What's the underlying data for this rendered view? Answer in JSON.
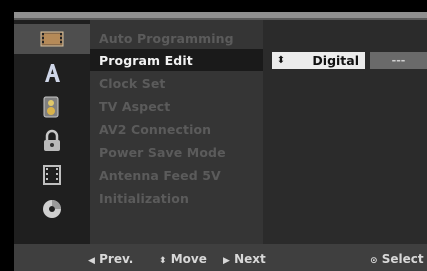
{
  "icons": [
    "video-icon",
    "language-icon",
    "audio-icon",
    "lock-icon",
    "recording-icon",
    "disc-icon"
  ],
  "menu": {
    "items": [
      {
        "label": "Auto Programming",
        "active": false
      },
      {
        "label": "Program Edit",
        "active": true
      },
      {
        "label": "Clock Set",
        "active": false
      },
      {
        "label": "TV Aspect",
        "active": false
      },
      {
        "label": "AV2 Connection",
        "active": false
      },
      {
        "label": "Power Save Mode",
        "active": false
      },
      {
        "label": "Antenna Feed 5V",
        "active": false
      },
      {
        "label": "Initialization",
        "active": false
      }
    ]
  },
  "option": {
    "arrows": "⬍",
    "value": "Digital",
    "secondary": "---"
  },
  "nav": {
    "prev": "Prev.",
    "move": "Move",
    "next": "Next",
    "select": "Select"
  },
  "colors": {
    "background": "#000000",
    "menu": "#353535",
    "active_text": "#f2f2f2",
    "inactive_text": "#5b5b5b",
    "option_box": "#ececec"
  }
}
